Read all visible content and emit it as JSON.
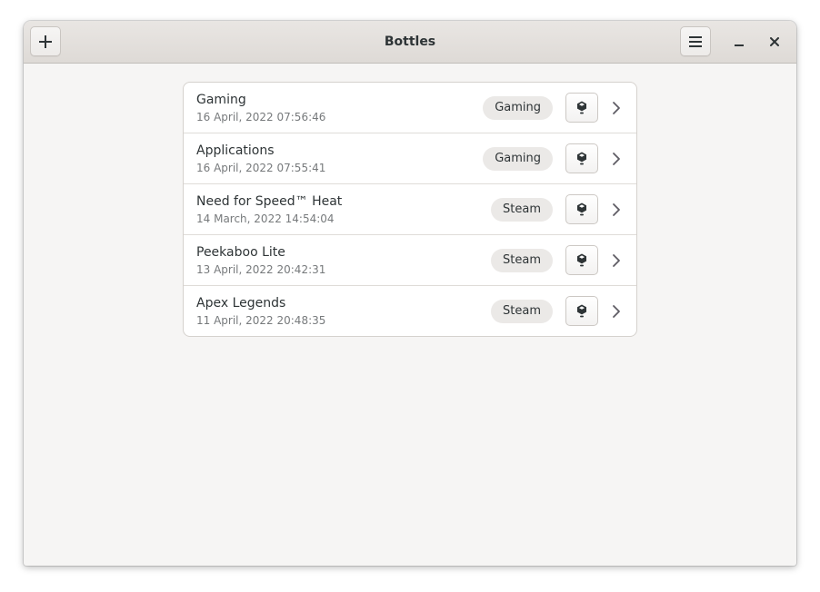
{
  "window": {
    "title": "Bottles"
  },
  "header": {
    "icons": {
      "add": "plus-icon",
      "menu": "hamburger-menu-icon",
      "minimize": "minimize-icon",
      "close": "close-icon"
    }
  },
  "bottles": [
    {
      "name": "Gaming",
      "date": "16 April, 2022 07:56:46",
      "environment": "Gaming"
    },
    {
      "name": "Applications",
      "date": "16 April, 2022 07:55:41",
      "environment": "Gaming"
    },
    {
      "name": "Need for Speed™ Heat",
      "date": "14 March, 2022 14:54:04",
      "environment": "Steam"
    },
    {
      "name": "Peekaboo Lite",
      "date": "13 April, 2022 20:42:31",
      "environment": "Steam"
    },
    {
      "name": "Apex Legends",
      "date": "11 April, 2022 20:48:35",
      "environment": "Steam"
    }
  ],
  "row_icons": {
    "run": "bottle-run-icon",
    "open": "chevron-right-icon"
  },
  "colors": {
    "window_bg": "#f6f5f4",
    "headerbar_bg": "#dedad6",
    "text": "#2e3436",
    "subtitle": "#777a7c",
    "badge_bg": "#ebe9e7"
  }
}
